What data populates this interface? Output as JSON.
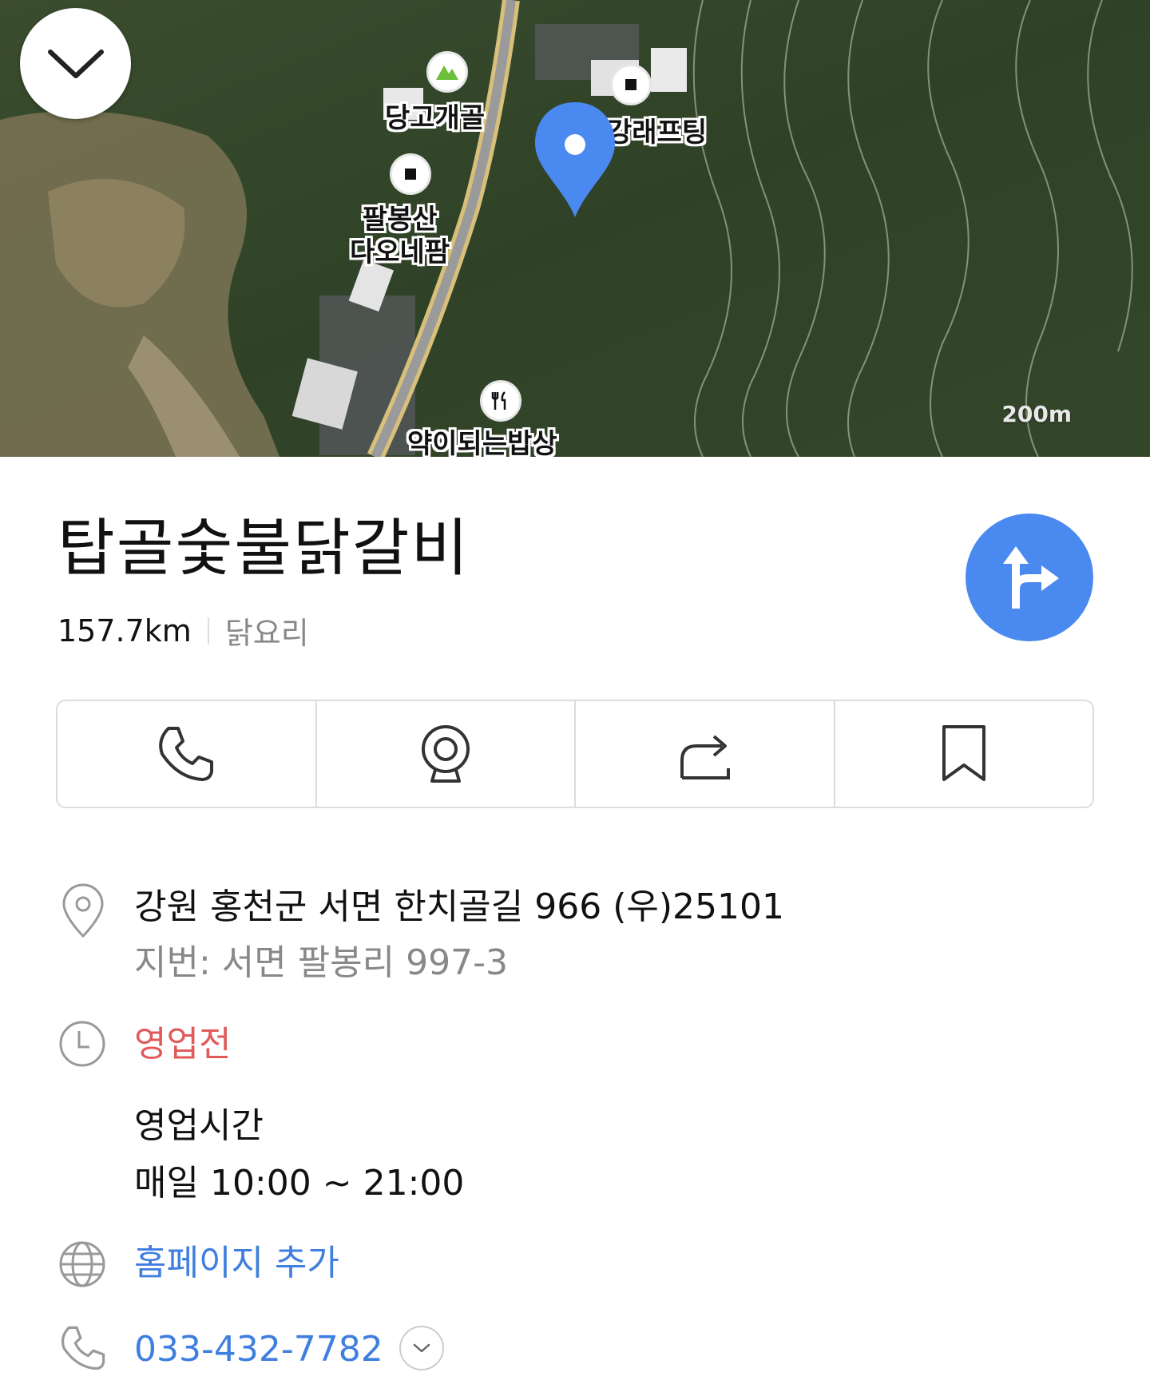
{
  "map": {
    "labels": {
      "danggogaegol": "당고개골",
      "rafting": "강래프팅",
      "palbongsan_line1": "팔봉산",
      "palbongsan_line2": "다오네팜",
      "restaurant": "약이되는밥상"
    },
    "scale": "200m"
  },
  "place": {
    "name": "탑골숯불닭갈비",
    "distance": "157.7km",
    "category": "닭요리"
  },
  "actions": {
    "icons": [
      "phone-icon",
      "roadview-icon",
      "share-icon",
      "bookmark-icon"
    ]
  },
  "info": {
    "address": "강원 홍천군 서면 한치골길 966 (우)25101",
    "lot_address": "지번: 서면 팔봉리 997-3",
    "status": "영업전",
    "hours_title": "영업시간",
    "hours": "매일 10:00 ~ 21:00",
    "homepage": "홈페이지 추가",
    "phone": "033-432-7782"
  },
  "colors": {
    "accent": "#4a89f0",
    "status_closed": "#e05a5a",
    "link": "#3f7fe0"
  }
}
